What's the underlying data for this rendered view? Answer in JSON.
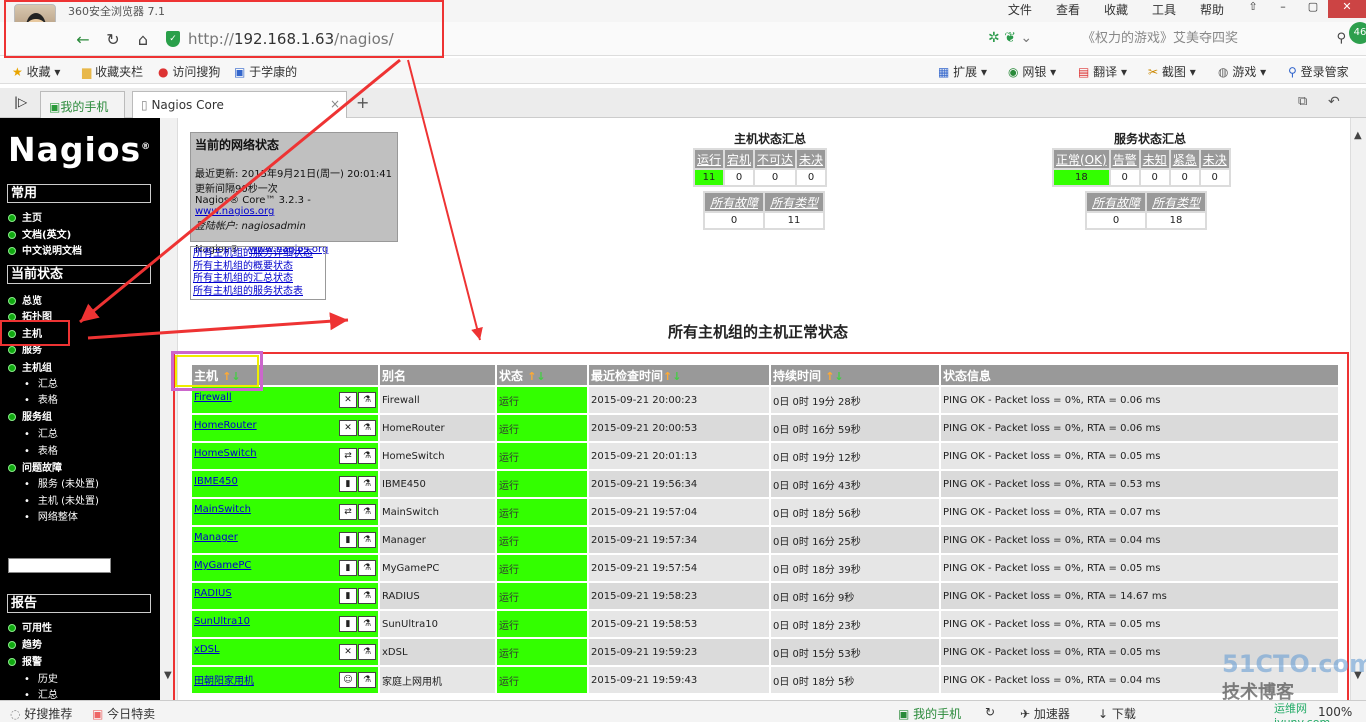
{
  "browser": {
    "brand": "360安全浏览器 7.1",
    "menu": [
      "文件",
      "查看",
      "收藏",
      "工具",
      "帮助"
    ],
    "url_prefix": "http://",
    "url_host": "192.168.1.63",
    "url_path": "/nagios/",
    "search_text": "《权力的游戏》艾美夺四奖",
    "badge": "46",
    "favorites": [
      "收藏",
      "收藏夹栏",
      "访问搜狗",
      "于学康的"
    ],
    "extensions": [
      "扩展",
      "网银",
      "翻译",
      "截图",
      "游戏",
      "登录管家"
    ],
    "tabs": [
      "我的手机",
      "Nagios Core"
    ]
  },
  "sidebar": {
    "logo": "Nagios",
    "sections": {
      "general": "常用",
      "current": "当前状态",
      "reports": "报告"
    },
    "general_items": [
      "主页",
      "文档(英文)",
      "中文说明文档"
    ],
    "current_items": [
      "总览",
      "拓扑图",
      "主机",
      "服务",
      "主机组",
      "服务组",
      "问题故障"
    ],
    "hostgroup_sub": [
      "汇总",
      "表格"
    ],
    "servicegroup_sub": [
      "汇总",
      "表格"
    ],
    "problem_sub": [
      "服务 (未处置)",
      "主机 (未处置)",
      "网络整体"
    ],
    "report_items": [
      "可用性",
      "趋势",
      "报警"
    ],
    "report_sub": [
      "历史",
      "汇总"
    ]
  },
  "netstatus": {
    "title": "当前的网络状态",
    "updated": "最近更新: 2015年9月21日(周一) 20:01:41",
    "interval": "更新间隔90秒一次",
    "version": "Nagios® Core™ 3.2.3 - ",
    "version_link": "www.nagios.org",
    "user": "登陆帐户: nagiosadmin",
    "brand": "Nagios® - ",
    "brand_link": "www.nagios.org",
    "links": [
      "所有主机组的服务详细状态",
      "所有主机组的概要状态",
      "所有主机组的汇总状态",
      "所有主机组的服务状态表"
    ]
  },
  "host_summary": {
    "title": "主机状态汇总",
    "headers": [
      "运行",
      "宕机",
      "不可达",
      "未决"
    ],
    "values": [
      "11",
      "0",
      "0",
      "0"
    ],
    "headers2": [
      "所有故障",
      "所有类型"
    ],
    "values2": [
      "0",
      "11"
    ]
  },
  "service_summary": {
    "title": "服务状态汇总",
    "headers": [
      "正常(OK)",
      "告警",
      "未知",
      "紧急",
      "未决"
    ],
    "values": [
      "18",
      "0",
      "0",
      "0",
      "0"
    ],
    "headers2": [
      "所有故障",
      "所有类型"
    ],
    "values2": [
      "0",
      "18"
    ]
  },
  "main_title": "所有主机组的主机正常状态",
  "table": {
    "columns": [
      "主机",
      "别名",
      "状态",
      "最近检查时间",
      "持续时间",
      "状态信息"
    ],
    "sort_up": "↑",
    "sort_down": "↓",
    "rows": [
      {
        "host": "Firewall",
        "alias": "Firewall",
        "status": "运行",
        "last_check": "2015-09-21 20:00:23",
        "duration": "0日 0时 19分 28秒",
        "info": "PING OK - Packet loss = 0%, RTA = 0.06 ms"
      },
      {
        "host": "HomeRouter",
        "alias": "HomeRouter",
        "status": "运行",
        "last_check": "2015-09-21 20:00:53",
        "duration": "0日 0时 16分 59秒",
        "info": "PING OK - Packet loss = 0%, RTA = 0.06 ms"
      },
      {
        "host": "HomeSwitch",
        "alias": "HomeSwitch",
        "status": "运行",
        "last_check": "2015-09-21 20:01:13",
        "duration": "0日 0时 19分 12秒",
        "info": "PING OK - Packet loss = 0%, RTA = 0.05 ms"
      },
      {
        "host": "IBME450",
        "alias": "IBME450",
        "status": "运行",
        "last_check": "2015-09-21 19:56:34",
        "duration": "0日 0时 16分 43秒",
        "info": "PING OK - Packet loss = 0%, RTA = 0.53 ms"
      },
      {
        "host": "MainSwitch",
        "alias": "MainSwitch",
        "status": "运行",
        "last_check": "2015-09-21 19:57:04",
        "duration": "0日 0时 18分 56秒",
        "info": "PING OK - Packet loss = 0%, RTA = 0.07 ms"
      },
      {
        "host": "Manager",
        "alias": "Manager",
        "status": "运行",
        "last_check": "2015-09-21 19:57:34",
        "duration": "0日 0时 16分 25秒",
        "info": "PING OK - Packet loss = 0%, RTA = 0.04 ms"
      },
      {
        "host": "MyGamePC",
        "alias": "MyGamePC",
        "status": "运行",
        "last_check": "2015-09-21 19:57:54",
        "duration": "0日 0时 18分 39秒",
        "info": "PING OK - Packet loss = 0%, RTA = 0.05 ms"
      },
      {
        "host": "RADIUS",
        "alias": "RADIUS",
        "status": "运行",
        "last_check": "2015-09-21 19:58:23",
        "duration": "0日 0时 16分 9秒",
        "info": "PING OK - Packet loss = 0%, RTA = 14.67 ms"
      },
      {
        "host": "SunUltra10",
        "alias": "SunUltra10",
        "status": "运行",
        "last_check": "2015-09-21 19:58:53",
        "duration": "0日 0时 18分 23秒",
        "info": "PING OK - Packet loss = 0%, RTA = 0.05 ms"
      },
      {
        "host": "xDSL",
        "alias": "xDSL",
        "status": "运行",
        "last_check": "2015-09-21 19:59:23",
        "duration": "0日 0时 15分 53秒",
        "info": "PING OK - Packet loss = 0%, RTA = 0.05 ms"
      },
      {
        "host": "田朝阳家用机",
        "alias": "家庭上网用机",
        "status": "运行",
        "last_check": "2015-09-21 19:59:43",
        "duration": "0日 0时 18分 5秒",
        "info": "PING OK - Packet loss = 0%, RTA = 0.04 ms"
      }
    ]
  },
  "statusbar": {
    "left1": "好搜推荐",
    "left2": "今日特卖",
    "phone": "我的手机",
    "accel": "加速器",
    "download": "下载",
    "zoom": "100%"
  },
  "watermark": {
    "line1": "51CTO.com",
    "line2": "技术博客",
    "line3": "运维网 iyunv.com"
  },
  "colors": {
    "ok_green": "#33ff00",
    "header_gray": "#999999",
    "highlight_red": "#ee3333"
  }
}
